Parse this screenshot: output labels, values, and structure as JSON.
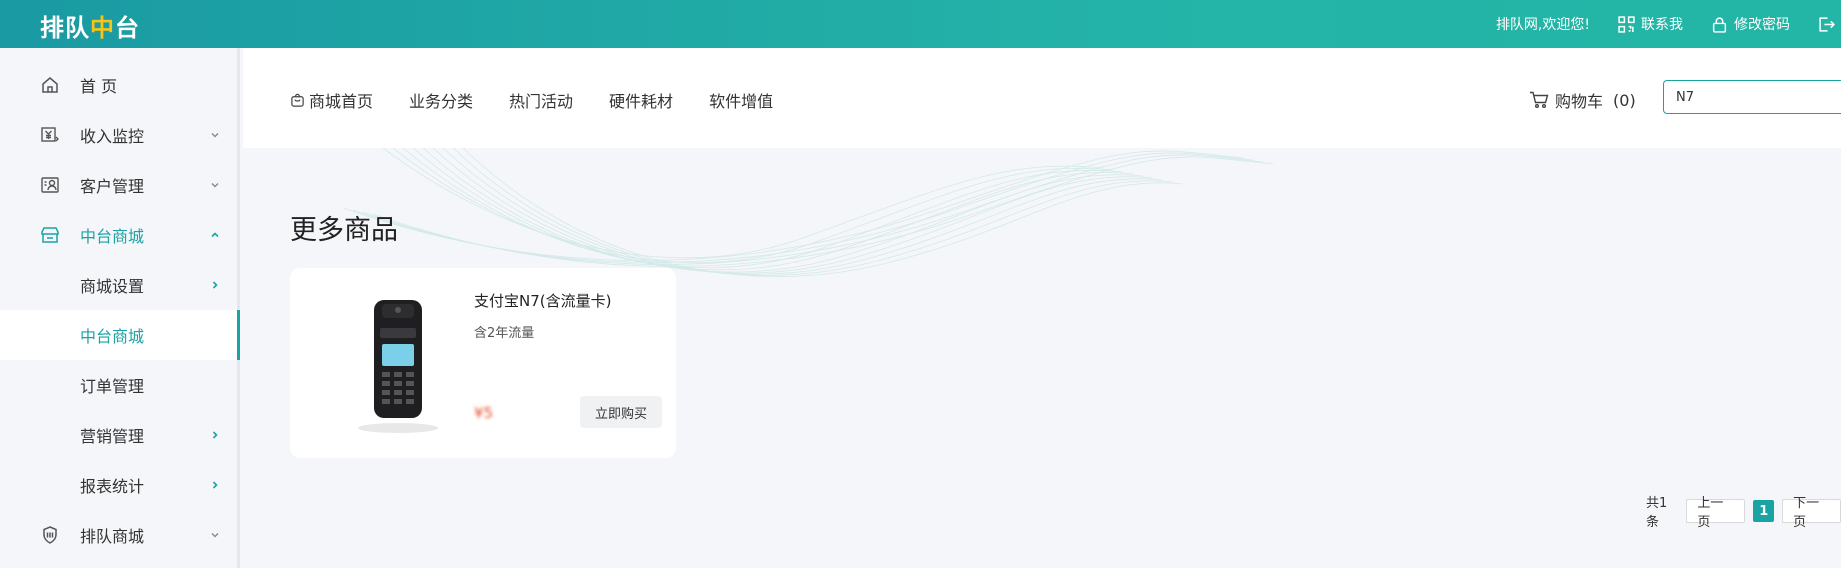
{
  "app": {
    "logo_main": "排队",
    "logo_accent": "中",
    "logo_tail": "台",
    "brand_color": "#1aa3a3"
  },
  "topbar": {
    "welcome": "排队网,欢迎您!",
    "contact": "联系我",
    "change_password": "修改密码"
  },
  "sidebar": {
    "items": [
      {
        "label": "首 页",
        "icon": "home-icon"
      },
      {
        "label": "收入监控",
        "icon": "income-icon"
      },
      {
        "label": "客户管理",
        "icon": "customer-icon"
      },
      {
        "label": "中台商城",
        "icon": "store-icon"
      },
      {
        "label": "商城设置"
      },
      {
        "label": "中台商城"
      },
      {
        "label": "订单管理"
      },
      {
        "label": "营销管理"
      },
      {
        "label": "报表统计"
      },
      {
        "label": "排队商城",
        "icon": "shield-icon"
      }
    ]
  },
  "mall": {
    "nav": [
      "商城首页",
      "业务分类",
      "热门活动",
      "硬件耗材",
      "软件增值"
    ],
    "cart_label": "购物车",
    "cart_count": "(0)",
    "search_value": "N7"
  },
  "section_title": "更多商品",
  "product": {
    "name": "支付宝N7(含流量卡)",
    "desc": "含2年流量",
    "price": "¥5",
    "buy_label": "立即购买"
  },
  "pager": {
    "total": "共1条",
    "prev": "上一页",
    "current": "1",
    "next": "下一页"
  }
}
